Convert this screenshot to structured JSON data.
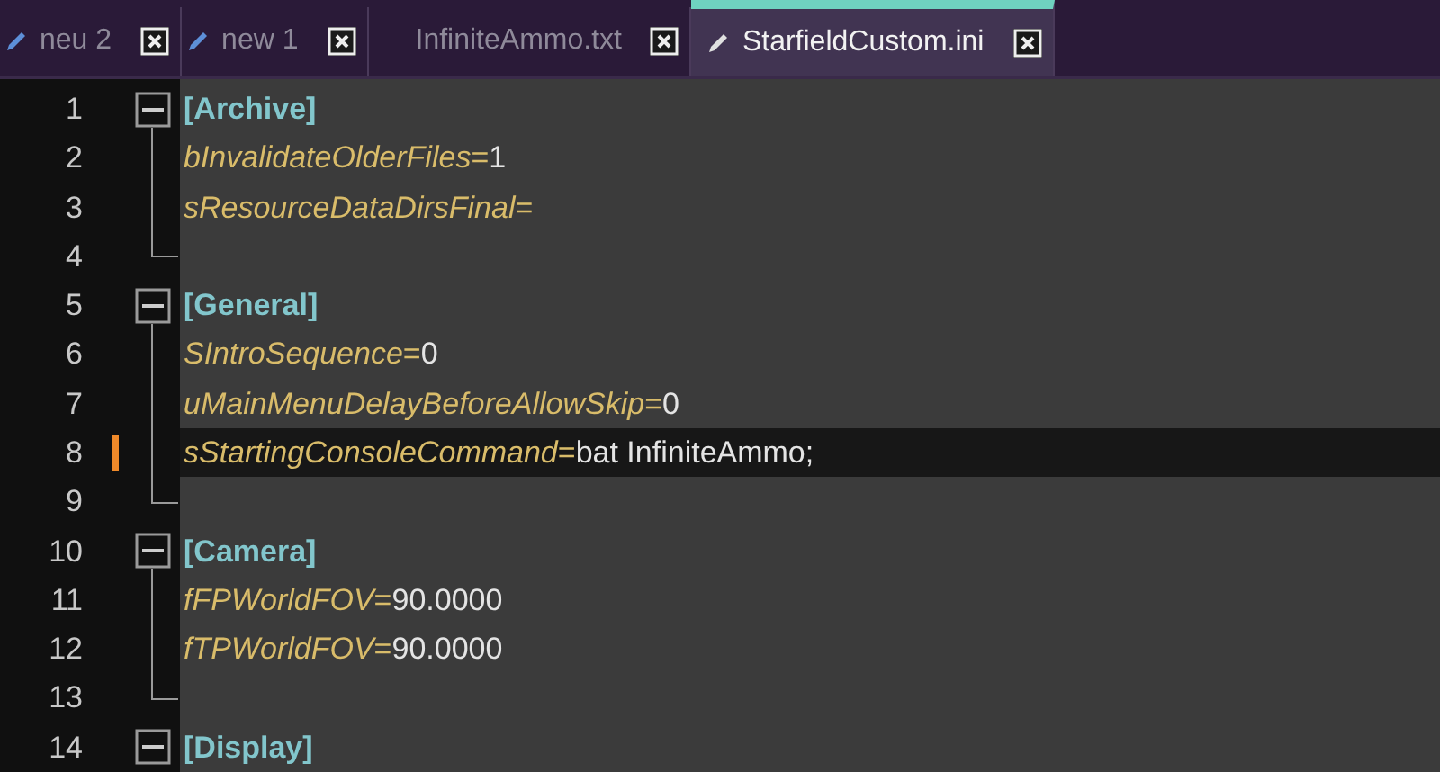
{
  "tabs": [
    {
      "label": "neu 2",
      "modified": true,
      "selected": false
    },
    {
      "label": "new 1",
      "modified": true,
      "selected": false
    },
    {
      "label": "InfiniteAmmo.txt",
      "modified": false,
      "selected": false
    },
    {
      "label": "StarfieldCustom.ini",
      "modified": true,
      "selected": true
    }
  ],
  "lines": [
    {
      "number": "1",
      "kind": "section",
      "text": "[Archive]",
      "expanded": true
    },
    {
      "number": "2",
      "kind": "keyvalue",
      "key": "bInvalidateOlderFiles",
      "sep": "=",
      "value": "1"
    },
    {
      "number": "3",
      "kind": "keyvalue",
      "key": "sResourceDataDirsFinal",
      "sep": "="
    },
    {
      "number": "4",
      "kind": "blank"
    },
    {
      "number": "5",
      "kind": "section",
      "text": "[General]",
      "expanded": true
    },
    {
      "number": "6",
      "kind": "keyvalue",
      "key": "SIntroSequence",
      "sep": "=",
      "value": "0"
    },
    {
      "number": "7",
      "kind": "keyvalue",
      "key": "uMainMenuDelayBeforeAllowSkip",
      "sep": "=",
      "value": "0"
    },
    {
      "number": "8",
      "kind": "keyvalue",
      "key": "sStartingConsoleCommand",
      "sep": "=",
      "value": "bat InfiniteAmmo;",
      "current": true,
      "changed": true
    },
    {
      "number": "9",
      "kind": "blank"
    },
    {
      "number": "10",
      "kind": "section",
      "text": "[Camera]",
      "expanded": true
    },
    {
      "number": "11",
      "kind": "keyvalue",
      "key": "fFPWorldFOV",
      "sep": "=",
      "value": "90.0000"
    },
    {
      "number": "12",
      "kind": "keyvalue",
      "key": "fTPWorldFOV",
      "sep": "=",
      "value": "90.0000"
    },
    {
      "number": "13",
      "kind": "blank"
    },
    {
      "number": "14",
      "kind": "section",
      "text": "[Display]",
      "expanded": true
    }
  ]
}
